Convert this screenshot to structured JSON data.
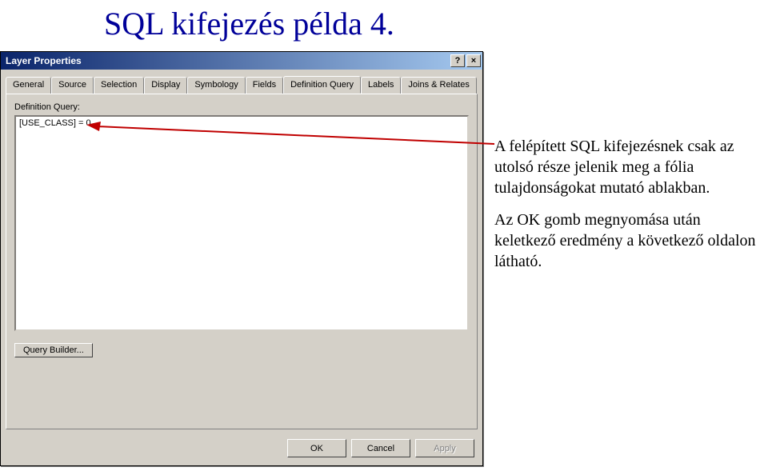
{
  "slide": {
    "title": "SQL kifejezés példa 4."
  },
  "dialog": {
    "title": "Layer Properties",
    "help_btn": "?",
    "close_btn": "×",
    "tabs": [
      {
        "label": "General"
      },
      {
        "label": "Source"
      },
      {
        "label": "Selection"
      },
      {
        "label": "Display"
      },
      {
        "label": "Symbology"
      },
      {
        "label": "Fields"
      },
      {
        "label": "Definition Query"
      },
      {
        "label": "Labels"
      },
      {
        "label": "Joins & Relates"
      }
    ],
    "active_tab_index": 6,
    "defquery_label": "Definition Query:",
    "defquery_value": "[USE_CLASS] = 0",
    "query_builder_btn": "Query Builder...",
    "ok_btn": "OK",
    "cancel_btn": "Cancel",
    "apply_btn": "Apply"
  },
  "annotation": {
    "p1": "A felépített SQL kifejezésnek csak az utolsó része jelenik meg a fólia tulajdonságokat mutató ablakban.",
    "p2": "Az OK gomb megnyomása után keletkező eredmény a következő oldalon látható."
  },
  "colors": {
    "arrow": "#c00000",
    "title": "#000099"
  }
}
